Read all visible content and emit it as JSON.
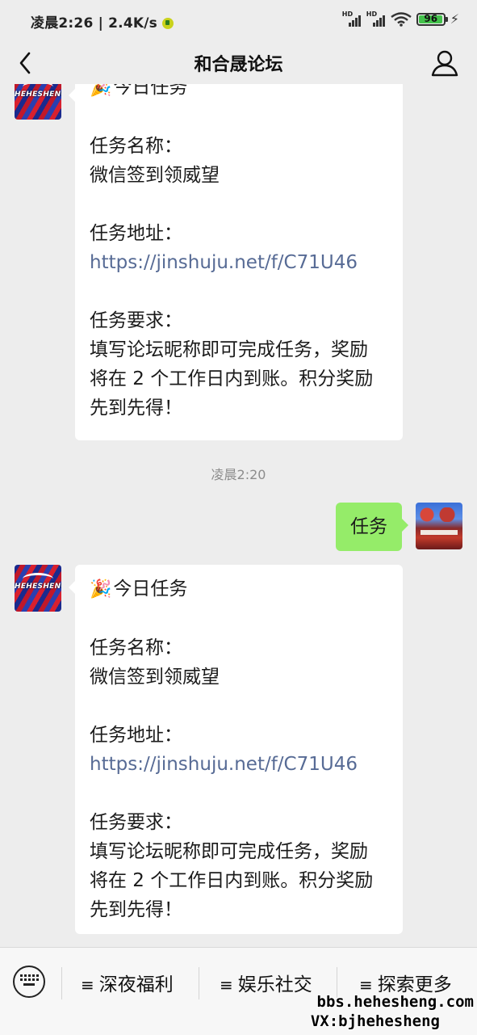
{
  "status_bar": {
    "time_speed": "凌晨2:26 | 2.4K/s",
    "signal1_label": "HD",
    "signal2_label": "HD",
    "battery_level": "96",
    "battery_fraction": 0.96
  },
  "header": {
    "title": "和合晟论坛"
  },
  "chat": {
    "bot_avatar_text": "HEHESHENG",
    "messages": [
      {
        "sender": "bot",
        "heading": "今日任务",
        "name_label": "任务名称：",
        "name_value": "微信签到领威望",
        "addr_label": "任务地址：",
        "addr_link": "https://jinshuju.net/f/C71U46",
        "req_label": "任务要求：",
        "req_line1": "填写论坛昵称即可完成任务，奖励",
        "req_line2": "将在 2 个工作日内到账。积分奖励",
        "req_line3": "先到先得！"
      },
      {
        "sender": "time",
        "text": "凌晨2:20"
      },
      {
        "sender": "me",
        "text": "任务"
      },
      {
        "sender": "bot",
        "heading": "今日任务",
        "name_label": "任务名称：",
        "name_value": "微信签到领威望",
        "addr_label": "任务地址：",
        "addr_link": "https://jinshuju.net/f/C71U46",
        "req_label": "任务要求：",
        "req_line1": "填写论坛昵称即可完成任务，奖励",
        "req_line2": "将在 2 个工作日内到账。积分奖励",
        "req_line3": "先到先得！"
      }
    ]
  },
  "bottom_menu": {
    "items": [
      {
        "label": "深夜福利"
      },
      {
        "label": "娱乐社交"
      },
      {
        "label": "探索更多"
      }
    ]
  },
  "watermark": {
    "line1": "bbs.hehesheng.com",
    "line2": "VX:bjhehesheng"
  }
}
